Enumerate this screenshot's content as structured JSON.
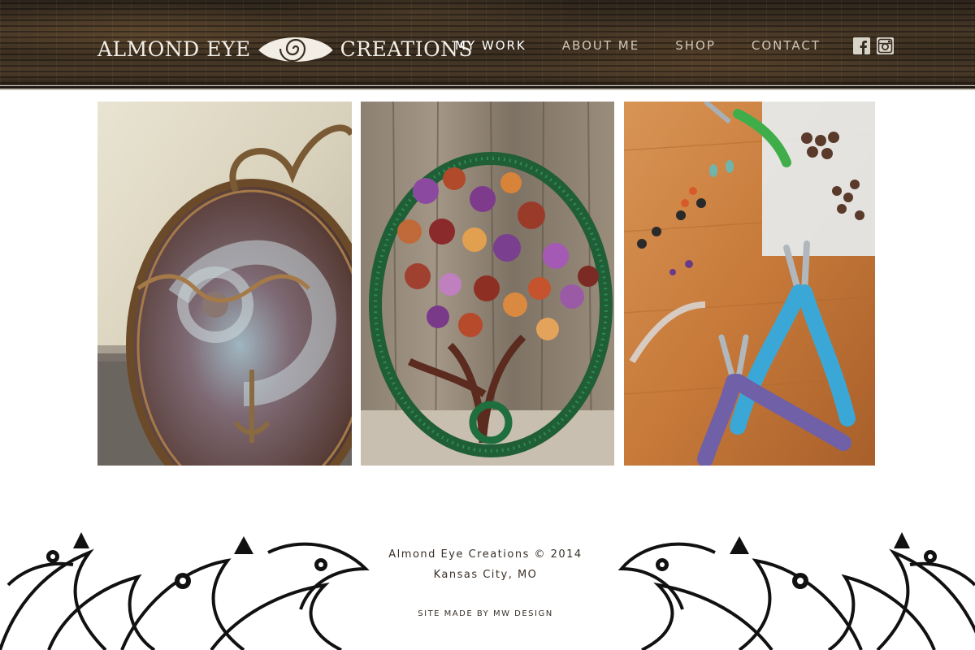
{
  "brand": {
    "name_left": "ALMOND EYE",
    "name_right": "CREATIONS",
    "logo_icon": "spiral-eye-logo"
  },
  "nav": {
    "items": [
      {
        "label": "MY WORK",
        "active": true
      },
      {
        "label": "ABOUT ME",
        "active": false
      },
      {
        "label": "SHOP",
        "active": false
      },
      {
        "label": "CONTACT",
        "active": false
      }
    ]
  },
  "social": {
    "facebook_icon": "facebook-icon",
    "instagram_icon": "instagram-icon"
  },
  "gallery": {
    "items": [
      {
        "subject": "ammonite-fossil-pendant-photo"
      },
      {
        "subject": "tree-of-life-wire-pendant-photo"
      },
      {
        "subject": "jewelry-tools-and-beads-photo"
      }
    ]
  },
  "footer": {
    "copyright": "Almond Eye Creations © 2014",
    "location": "Kansas City, MO",
    "credit": "SITE MADE BY MW DESIGN"
  },
  "colors": {
    "header_wood": "#3a2e20",
    "nav_text": "#cfc6b8",
    "nav_active": "#ffffff",
    "footer_text": "#3a3028",
    "background": "#ffffff"
  }
}
